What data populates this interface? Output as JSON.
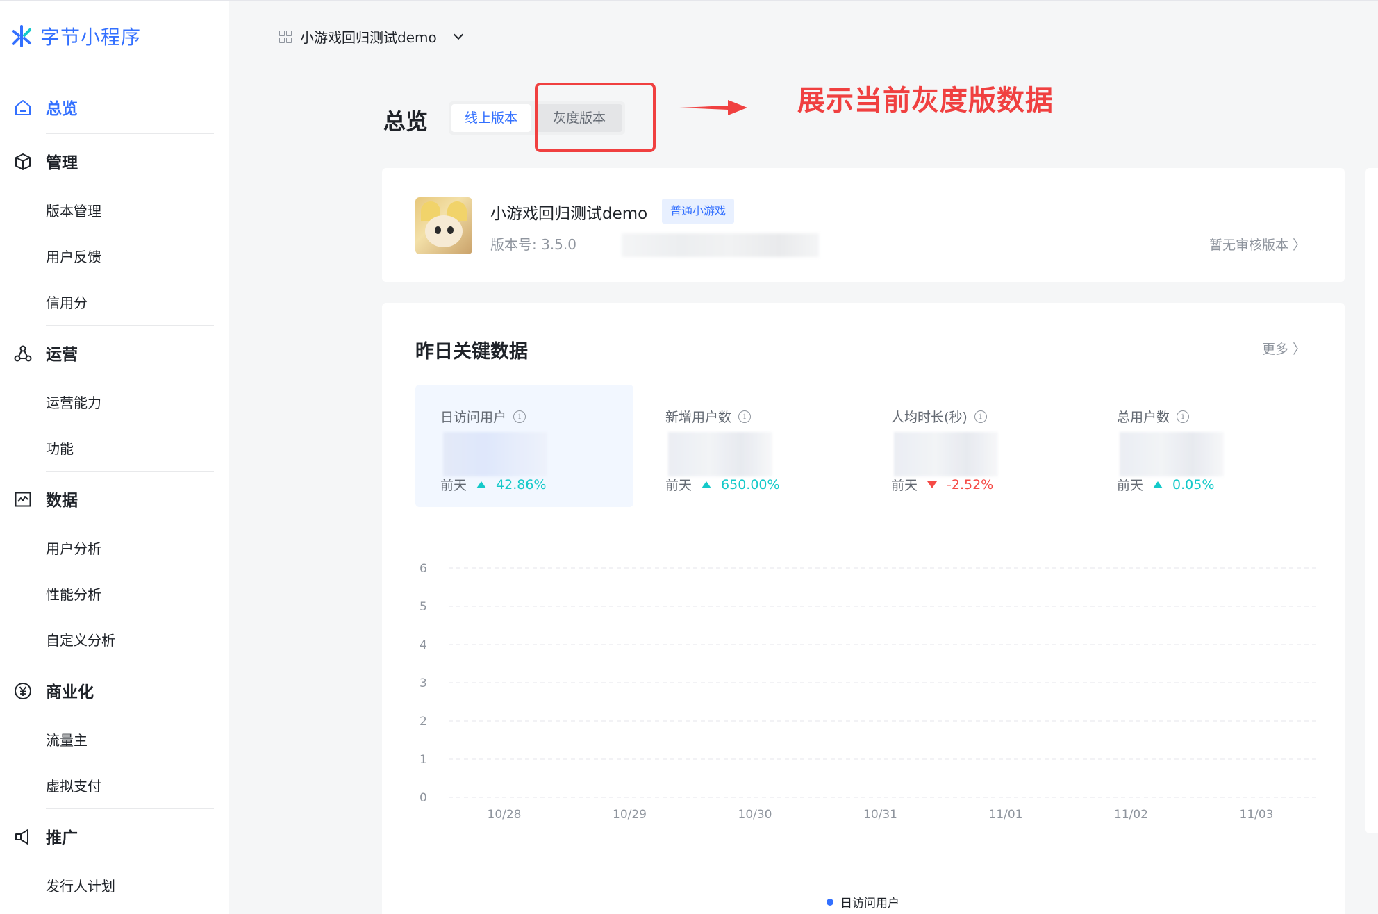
{
  "brand": {
    "name": "字节小程序",
    "accent": "#3370ff"
  },
  "sidebar": {
    "groups": [
      {
        "label": "总览",
        "icon": "home-icon",
        "active": true,
        "items": []
      },
      {
        "label": "管理",
        "icon": "cube-icon",
        "items": [
          "版本管理",
          "用户反馈",
          "信用分"
        ]
      },
      {
        "label": "运营",
        "icon": "share-nodes-icon",
        "items": [
          "运营能力",
          "功能"
        ]
      },
      {
        "label": "数据",
        "icon": "chart-line-icon",
        "items": [
          "用户分析",
          "性能分析",
          "自定义分析"
        ]
      },
      {
        "label": "商业化",
        "icon": "yuan-icon",
        "items": [
          "流量主",
          "虚拟支付"
        ]
      },
      {
        "label": "推广",
        "icon": "megaphone-icon",
        "items": [
          "发行人计划"
        ]
      }
    ]
  },
  "topbar": {
    "app_name": "小游戏回归测试demo"
  },
  "page": {
    "title": "总览",
    "tabs": [
      {
        "label": "线上版本",
        "selected": true
      },
      {
        "label": "灰度版本",
        "selected": false
      }
    ],
    "annotation": "展示当前灰度版数据",
    "annotation_color": "#f04040"
  },
  "app_info": {
    "name": "小游戏回归测试demo",
    "tag": "普通小游戏",
    "version": "版本号: 3.5.0",
    "review_link": "暂无审核版本 〉"
  },
  "key_data": {
    "title": "昨日关键数据",
    "more": "更多 〉",
    "metrics": [
      {
        "label": "日访问用户",
        "compare_label": "前天",
        "change": "42.86%",
        "direction": "up",
        "selected": true
      },
      {
        "label": "新增用户数",
        "compare_label": "前天",
        "change": "650.00%",
        "direction": "up"
      },
      {
        "label": "人均时长(秒)",
        "compare_label": "前天",
        "change": "-2.52%",
        "direction": "down"
      },
      {
        "label": "总用户数",
        "compare_label": "前天",
        "change": "0.05%",
        "direction": "up"
      }
    ]
  },
  "chart_data": {
    "type": "line",
    "categories": [
      "10/28",
      "10/29",
      "10/30",
      "10/31",
      "11/01",
      "11/02",
      "11/03"
    ],
    "series": [
      {
        "name": "日访问用户",
        "values": [
          null,
          null,
          null,
          null,
          null,
          null,
          null
        ]
      }
    ],
    "y_ticks": [
      0,
      1,
      2,
      3,
      4,
      5,
      6
    ],
    "ylim": [
      0,
      6
    ],
    "grid": "horizontal-dashed",
    "legend": "bottom-center",
    "series_color": "#3370ff"
  }
}
